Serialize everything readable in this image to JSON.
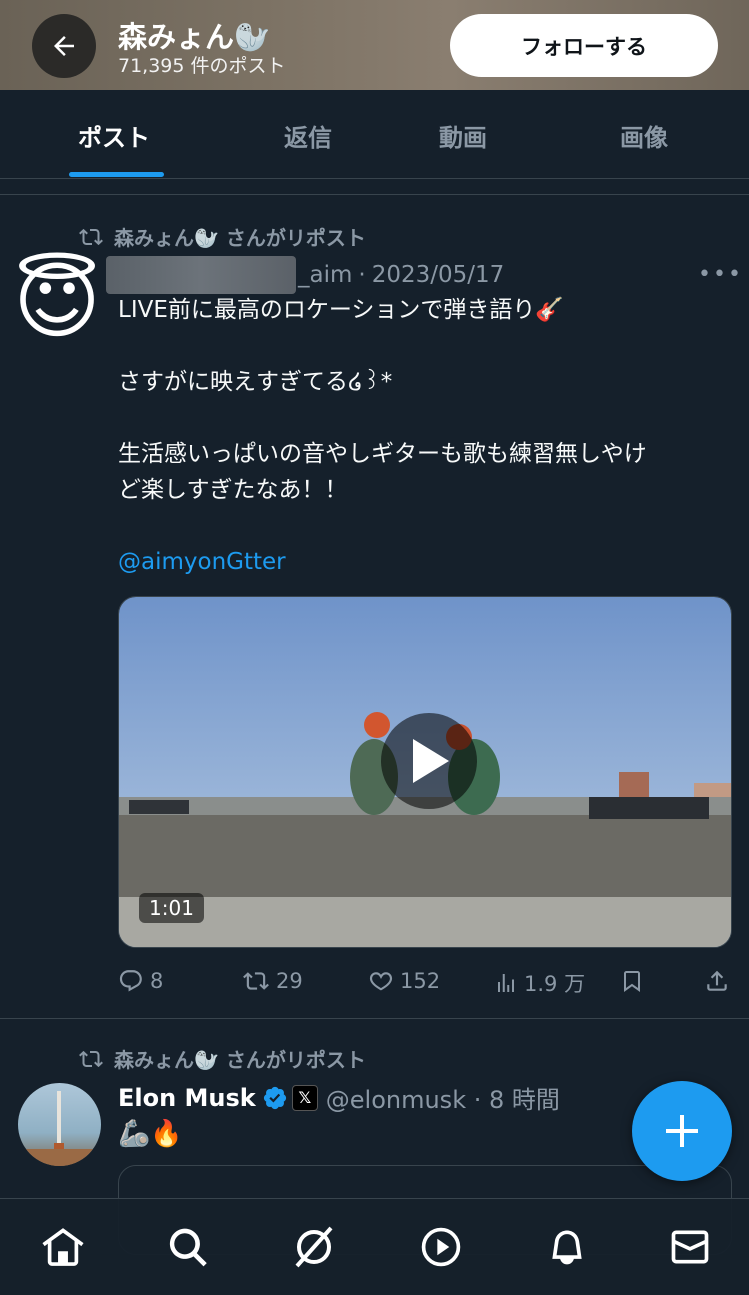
{
  "header": {
    "name": "森みょん🦭",
    "post_count": "71,395 件のポスト",
    "follow_label": "フォローする"
  },
  "tabs": [
    {
      "label": "ポスト",
      "active": true
    },
    {
      "label": "返信",
      "active": false
    },
    {
      "label": "動画",
      "active": false
    },
    {
      "label": "画像",
      "active": false
    }
  ],
  "posts": [
    {
      "repost_by": "森みょん🦭 さんがリポスト",
      "avatar_emoji": "😇",
      "handle_suffix": "_aim",
      "date": "2023/05/17",
      "text_lines": [
        "LIVE前に最高のロケーションで弾き語り🎸",
        "さすがに映えすぎてる໒꒱*",
        "生活感いっぱいの音やしギターも歌も練習無しやけ",
        "ど楽しすぎたなあ！！"
      ],
      "mention": "@aimyonGtter",
      "video_duration": "1:01",
      "stats": {
        "replies": "8",
        "reposts": "29",
        "likes": "152",
        "views": "1.9 万"
      }
    },
    {
      "repost_by": "森みょん🦭 さんがリポスト",
      "name": "Elon Musk",
      "handle": "@elonmusk · 8 時間",
      "text": "🦾🔥"
    }
  ],
  "colors": {
    "accent": "#1d9bf0",
    "background": "#15202b",
    "muted": "#8b98a5"
  }
}
